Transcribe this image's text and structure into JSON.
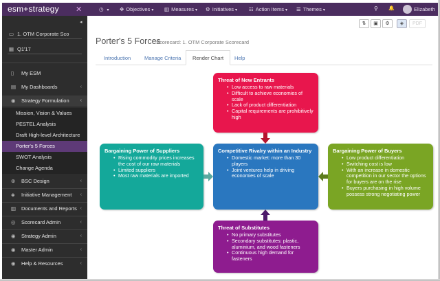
{
  "app": {
    "logo": "esm+strategy",
    "logo_mark": "✕"
  },
  "nav": [
    {
      "icon": "◷",
      "label": "",
      "caret": "▾"
    },
    {
      "icon": "✥",
      "label": "Objectives",
      "caret": "▾"
    },
    {
      "icon": "▥",
      "label": "Measures",
      "caret": "▾"
    },
    {
      "icon": "⚙",
      "label": "Initiatives",
      "caret": "▾"
    },
    {
      "icon": "☷",
      "label": "Action Items",
      "caret": "▾"
    },
    {
      "icon": "☰",
      "label": "Themes",
      "caret": "▾"
    }
  ],
  "top_icons": {
    "search": "⚲",
    "bell": "🔔"
  },
  "user": {
    "name": "Elizabeth"
  },
  "sidebar": {
    "collapse_icon": "◂",
    "org": "1. OTM Corporate Sco",
    "period": "Q1'17",
    "items": [
      {
        "label": "My ESM",
        "icon": "▯"
      },
      {
        "label": "My Dashboards",
        "icon": "▤"
      },
      {
        "label": "Strategy Formulation",
        "icon": "◉"
      }
    ],
    "sub_items": [
      "Mission, Vision & Values",
      "PESTEL Analysis",
      "Draft High-level Architecture",
      "Porter's 5 Forces",
      "SWOT Analysis",
      "Change Agenda"
    ],
    "lower_items": [
      {
        "label": "BSC Design",
        "icon": "⊕"
      },
      {
        "label": "Initiative Management",
        "icon": "◈"
      },
      {
        "label": "Documents and Reports",
        "icon": "▥"
      },
      {
        "label": "Scorecard Admin",
        "icon": "◎"
      },
      {
        "label": "Strategy Admin",
        "icon": "◉"
      },
      {
        "label": "Master Admin",
        "icon": "◉"
      },
      {
        "label": "Help & Resources",
        "icon": "◉"
      }
    ],
    "chevron": "‹"
  },
  "toolbar": {
    "btn1": "⇅",
    "btn2": "▣",
    "btn3": "⚙",
    "btn4": "◈",
    "btn5": "PDF"
  },
  "page": {
    "title": "Porter's 5 Forces",
    "scorecard": "Scorecard: 1. OTM Corporate Scorecard"
  },
  "tabs": [
    {
      "label": "Introduction"
    },
    {
      "label": "Manage Criteria"
    },
    {
      "label": "Render Chart"
    },
    {
      "label": "Help"
    }
  ],
  "forces": {
    "entrants": {
      "title": "Threat of New Entrants",
      "items": [
        "Low access to raw materials",
        "Difficult to achieve economies of scale",
        "Lack of product differentiation",
        "Capital requirements are prohibitively high"
      ],
      "color": "#e8164d"
    },
    "suppliers": {
      "title": "Bargaining Power of Suppliers",
      "items": [
        "Rising commodity prices increases the cost of our raw materials",
        "Limited suppliers",
        "Most raw materials are imported"
      ],
      "color": "#14a89a"
    },
    "rivalry": {
      "title": "Competitive Rivalry within an Industry",
      "items": [
        "Domestic market: more than 30 players",
        "Joint ventures help in driving economies of scale"
      ],
      "color": "#2a77bf"
    },
    "buyers": {
      "title": "Bargaining Power of Buyers",
      "items": [
        "Low product differentiation",
        "Switching cost is low",
        "With an increase in domestic competition in our sector the options for buyers are on the rise",
        "Buyers purchasing in high volume possess strong negotiating power"
      ],
      "color": "#7aa524"
    },
    "substitutes": {
      "title": "Threat of Substitutes",
      "items": [
        "No primary substitutes",
        "Secondary substitutes: plastic, aluminium, and wood fasteners",
        "Continuous high demand for fasteners"
      ],
      "color": "#8e1c8f"
    }
  }
}
